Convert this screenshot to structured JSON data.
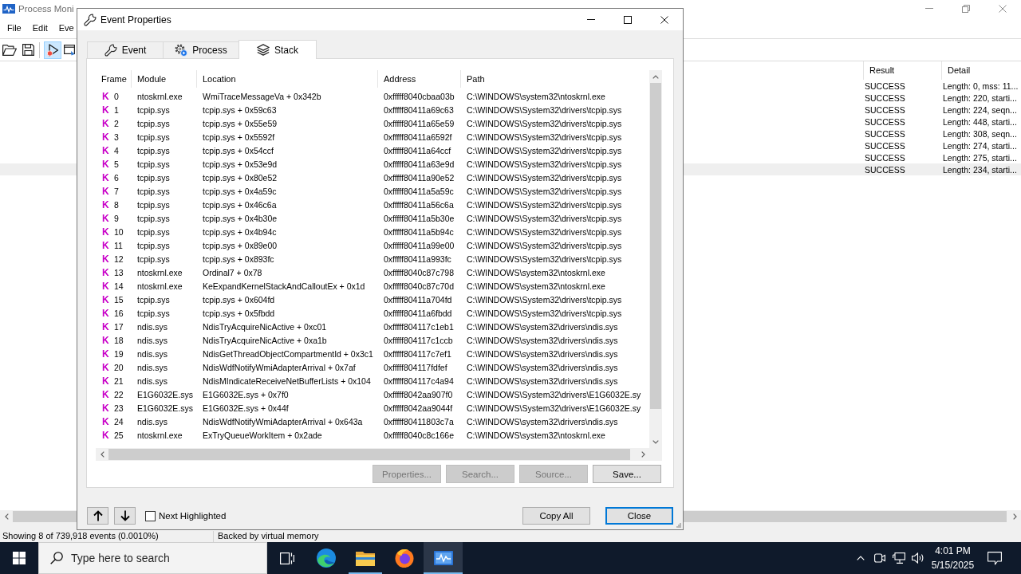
{
  "app_window": {
    "title": "Process Moni",
    "menu": [
      "File",
      "Edit",
      "Eve"
    ],
    "toolbar": [
      {
        "kind": "open",
        "selected": false
      },
      {
        "kind": "save",
        "selected": false
      },
      {
        "kind": "capture",
        "selected": true
      },
      {
        "kind": "window",
        "selected": false
      }
    ]
  },
  "event_list": {
    "columns": [
      "Result",
      "Detail"
    ],
    "rows": [
      {
        "result": "SUCCESS",
        "detail": "Length: 0, mss: 11...",
        "selected": false
      },
      {
        "result": "SUCCESS",
        "detail": "Length: 220, starti...",
        "selected": false
      },
      {
        "result": "SUCCESS",
        "detail": "Length: 224, seqn...",
        "selected": false
      },
      {
        "result": "SUCCESS",
        "detail": "Length: 448, starti...",
        "selected": false
      },
      {
        "result": "SUCCESS",
        "detail": "Length: 308, seqn...",
        "selected": false
      },
      {
        "result": "SUCCESS",
        "detail": "Length: 274, starti...",
        "selected": false
      },
      {
        "result": "SUCCESS",
        "detail": "Length: 275, starti...",
        "selected": false
      },
      {
        "result": "SUCCESS",
        "detail": "Length: 234, starti...",
        "selected": true
      }
    ]
  },
  "status_bar": [
    "Showing 8 of 739,918 events (0.0010%)",
    "Backed by virtual memory"
  ],
  "dialog": {
    "title": "Event Properties",
    "tabs": [
      {
        "label": "Event",
        "kind": "event",
        "selected": false
      },
      {
        "label": "Process",
        "kind": "process",
        "selected": false
      },
      {
        "label": "Stack",
        "kind": "stack",
        "selected": true
      }
    ],
    "stack": {
      "columns": [
        "Frame",
        "Module",
        "Location",
        "Address",
        "Path"
      ],
      "rows": [
        {
          "mode": "K",
          "frame": "0",
          "module": "ntoskrnl.exe",
          "location": "WmiTraceMessageVa + 0x342b",
          "address": "0xfffff8040cbaa03b",
          "path": "C:\\WINDOWS\\system32\\ntoskrnl.exe"
        },
        {
          "mode": "K",
          "frame": "1",
          "module": "tcpip.sys",
          "location": "tcpip.sys + 0x59c63",
          "address": "0xfffff80411a69c63",
          "path": "C:\\WINDOWS\\System32\\drivers\\tcpip.sys"
        },
        {
          "mode": "K",
          "frame": "2",
          "module": "tcpip.sys",
          "location": "tcpip.sys + 0x55e59",
          "address": "0xfffff80411a65e59",
          "path": "C:\\WINDOWS\\System32\\drivers\\tcpip.sys"
        },
        {
          "mode": "K",
          "frame": "3",
          "module": "tcpip.sys",
          "location": "tcpip.sys + 0x5592f",
          "address": "0xfffff80411a6592f",
          "path": "C:\\WINDOWS\\System32\\drivers\\tcpip.sys"
        },
        {
          "mode": "K",
          "frame": "4",
          "module": "tcpip.sys",
          "location": "tcpip.sys + 0x54ccf",
          "address": "0xfffff80411a64ccf",
          "path": "C:\\WINDOWS\\System32\\drivers\\tcpip.sys"
        },
        {
          "mode": "K",
          "frame": "5",
          "module": "tcpip.sys",
          "location": "tcpip.sys + 0x53e9d",
          "address": "0xfffff80411a63e9d",
          "path": "C:\\WINDOWS\\System32\\drivers\\tcpip.sys"
        },
        {
          "mode": "K",
          "frame": "6",
          "module": "tcpip.sys",
          "location": "tcpip.sys + 0x80e52",
          "address": "0xfffff80411a90e52",
          "path": "C:\\WINDOWS\\System32\\drivers\\tcpip.sys"
        },
        {
          "mode": "K",
          "frame": "7",
          "module": "tcpip.sys",
          "location": "tcpip.sys + 0x4a59c",
          "address": "0xfffff80411a5a59c",
          "path": "C:\\WINDOWS\\System32\\drivers\\tcpip.sys"
        },
        {
          "mode": "K",
          "frame": "8",
          "module": "tcpip.sys",
          "location": "tcpip.sys + 0x46c6a",
          "address": "0xfffff80411a56c6a",
          "path": "C:\\WINDOWS\\System32\\drivers\\tcpip.sys"
        },
        {
          "mode": "K",
          "frame": "9",
          "module": "tcpip.sys",
          "location": "tcpip.sys + 0x4b30e",
          "address": "0xfffff80411a5b30e",
          "path": "C:\\WINDOWS\\System32\\drivers\\tcpip.sys"
        },
        {
          "mode": "K",
          "frame": "10",
          "module": "tcpip.sys",
          "location": "tcpip.sys + 0x4b94c",
          "address": "0xfffff80411a5b94c",
          "path": "C:\\WINDOWS\\System32\\drivers\\tcpip.sys"
        },
        {
          "mode": "K",
          "frame": "11",
          "module": "tcpip.sys",
          "location": "tcpip.sys + 0x89e00",
          "address": "0xfffff80411a99e00",
          "path": "C:\\WINDOWS\\System32\\drivers\\tcpip.sys"
        },
        {
          "mode": "K",
          "frame": "12",
          "module": "tcpip.sys",
          "location": "tcpip.sys + 0x893fc",
          "address": "0xfffff80411a993fc",
          "path": "C:\\WINDOWS\\System32\\drivers\\tcpip.sys"
        },
        {
          "mode": "K",
          "frame": "13",
          "module": "ntoskrnl.exe",
          "location": "Ordinal7 + 0x78",
          "address": "0xfffff8040c87c798",
          "path": "C:\\WINDOWS\\system32\\ntoskrnl.exe"
        },
        {
          "mode": "K",
          "frame": "14",
          "module": "ntoskrnl.exe",
          "location": "KeExpandKernelStackAndCalloutEx + 0x1d",
          "address": "0xfffff8040c87c70d",
          "path": "C:\\WINDOWS\\system32\\ntoskrnl.exe"
        },
        {
          "mode": "K",
          "frame": "15",
          "module": "tcpip.sys",
          "location": "tcpip.sys + 0x604fd",
          "address": "0xfffff80411a704fd",
          "path": "C:\\WINDOWS\\System32\\drivers\\tcpip.sys"
        },
        {
          "mode": "K",
          "frame": "16",
          "module": "tcpip.sys",
          "location": "tcpip.sys + 0x5fbdd",
          "address": "0xfffff80411a6fbdd",
          "path": "C:\\WINDOWS\\System32\\drivers\\tcpip.sys"
        },
        {
          "mode": "K",
          "frame": "17",
          "module": "ndis.sys",
          "location": "NdisTryAcquireNicActive + 0xc01",
          "address": "0xfffff804117c1eb1",
          "path": "C:\\WINDOWS\\system32\\drivers\\ndis.sys"
        },
        {
          "mode": "K",
          "frame": "18",
          "module": "ndis.sys",
          "location": "NdisTryAcquireNicActive + 0xa1b",
          "address": "0xfffff804117c1ccb",
          "path": "C:\\WINDOWS\\system32\\drivers\\ndis.sys"
        },
        {
          "mode": "K",
          "frame": "19",
          "module": "ndis.sys",
          "location": "NdisGetThreadObjectCompartmentId + 0x3c1",
          "address": "0xfffff804117c7ef1",
          "path": "C:\\WINDOWS\\system32\\drivers\\ndis.sys"
        },
        {
          "mode": "K",
          "frame": "20",
          "module": "ndis.sys",
          "location": "NdisWdfNotifyWmiAdapterArrival + 0x7af",
          "address": "0xfffff804117fdfef",
          "path": "C:\\WINDOWS\\system32\\drivers\\ndis.sys"
        },
        {
          "mode": "K",
          "frame": "21",
          "module": "ndis.sys",
          "location": "NdisMIndicateReceiveNetBufferLists + 0x104",
          "address": "0xfffff804117c4a94",
          "path": "C:\\WINDOWS\\system32\\drivers\\ndis.sys"
        },
        {
          "mode": "K",
          "frame": "22",
          "module": "E1G6032E.sys",
          "location": "E1G6032E.sys + 0x7f0",
          "address": "0xfffff8042aa907f0",
          "path": "C:\\WINDOWS\\System32\\drivers\\E1G6032E.sy"
        },
        {
          "mode": "K",
          "frame": "23",
          "module": "E1G6032E.sys",
          "location": "E1G6032E.sys + 0x44f",
          "address": "0xfffff8042aa9044f",
          "path": "C:\\WINDOWS\\System32\\drivers\\E1G6032E.sy"
        },
        {
          "mode": "K",
          "frame": "24",
          "module": "ndis.sys",
          "location": "NdisWdfNotifyWmiAdapterArrival + 0x643a",
          "address": "0xfffff80411803c7a",
          "path": "C:\\WINDOWS\\system32\\drivers\\ndis.sys"
        },
        {
          "mode": "K",
          "frame": "25",
          "module": "ntoskrnl.exe",
          "location": "ExTryQueueWorkItem + 0x2ade",
          "address": "0xfffff8040c8c166e",
          "path": "C:\\WINDOWS\\system32\\ntoskrnl.exe"
        }
      ]
    },
    "actions": [
      {
        "label": "Properties...",
        "disabled": true
      },
      {
        "label": "Search...",
        "disabled": true
      },
      {
        "label": "Source...",
        "disabled": true
      },
      {
        "label": "Save...",
        "disabled": false
      }
    ],
    "next_highlighted": {
      "label": "Next Highlighted",
      "checked": false
    },
    "footer_buttons": [
      {
        "label": "Copy All",
        "default": false
      },
      {
        "label": "Close",
        "default": true
      }
    ]
  },
  "taskbar": {
    "search": {
      "placeholder": "Type here to search"
    },
    "apps": [
      {
        "kind": "taskview",
        "open": false,
        "active": false
      },
      {
        "kind": "edge",
        "open": false,
        "active": false
      },
      {
        "kind": "explorer",
        "open": true,
        "active": false
      },
      {
        "kind": "firefox",
        "open": false,
        "active": false
      },
      {
        "kind": "procmon",
        "open": true,
        "active": true
      }
    ],
    "clock": {
      "time": "4:01 PM",
      "date": "5/15/2025"
    }
  }
}
